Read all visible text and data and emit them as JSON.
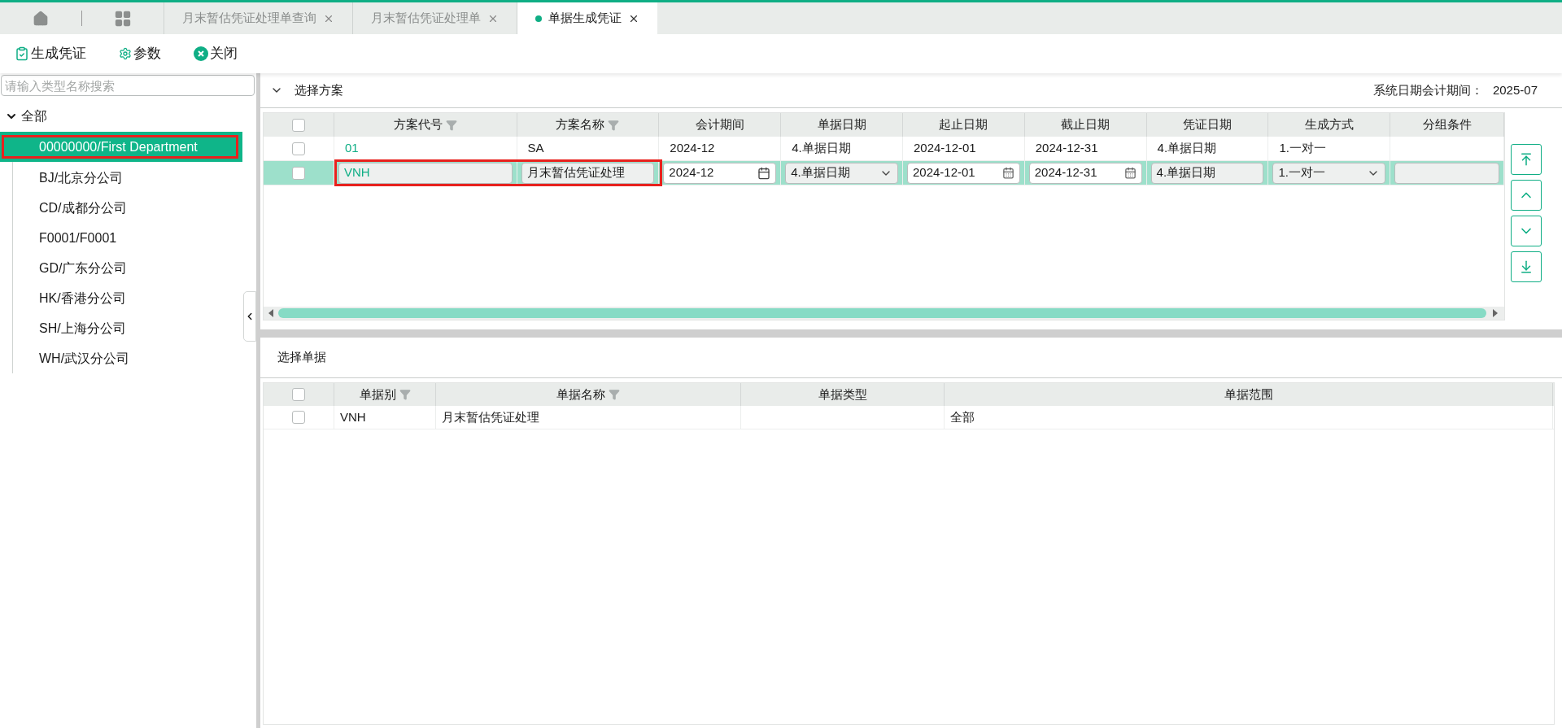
{
  "tabs": [
    {
      "label": "月末暂估凭证处理单查询",
      "selected": false
    },
    {
      "label": "月末暂估凭证处理单",
      "selected": false
    },
    {
      "label": "单据生成凭证",
      "selected": true
    }
  ],
  "toolbar": [
    {
      "kind": "generate",
      "label": "生成凭证"
    },
    {
      "kind": "settings",
      "label": "参数"
    },
    {
      "kind": "close",
      "label": "关闭"
    }
  ],
  "sidebar": {
    "search": {
      "placeholder": "请输入类型名称搜索"
    },
    "tree": {
      "label": "全部",
      "expanded": true,
      "children": [
        {
          "label": "00000000/First Department",
          "selected": true,
          "outlined": true
        },
        {
          "label": "BJ/北京分公司",
          "selected": false,
          "outlined": false
        },
        {
          "label": "CD/成都分公司",
          "selected": false,
          "outlined": false
        },
        {
          "label": "F0001/F0001",
          "selected": false,
          "outlined": false
        },
        {
          "label": "GD/广东分公司",
          "selected": false,
          "outlined": false
        },
        {
          "label": "HK/香港分公司",
          "selected": false,
          "outlined": false
        },
        {
          "label": "SH/上海分公司",
          "selected": false,
          "outlined": false
        },
        {
          "label": "WH/武汉分公司",
          "selected": false,
          "outlined": false
        }
      ]
    }
  },
  "scheme_panel": {
    "title": "选择方案",
    "expanded": true,
    "all_checked": false,
    "period_label": "系统日期会计期间：",
    "period_value": "2025-07",
    "columns": [
      {
        "label": "方案代号",
        "filter": true
      },
      {
        "label": "方案名称",
        "filter": true
      },
      {
        "label": "会计期间",
        "filter": false
      },
      {
        "label": "单据日期",
        "filter": false
      },
      {
        "label": "起止日期",
        "filter": false
      },
      {
        "label": "截止日期",
        "filter": false
      },
      {
        "label": "凭证日期",
        "filter": false
      },
      {
        "label": "生成方式",
        "filter": false
      },
      {
        "label": "分组条件",
        "filter": false
      }
    ],
    "rows": [
      {
        "selected": false,
        "checked": false,
        "cells": [
          {
            "kind": "text",
            "value": "01",
            "outlined": false
          },
          {
            "kind": "text",
            "value": "SA",
            "outlined": false
          },
          {
            "kind": "text",
            "value": "2024-12",
            "outlined": false
          },
          {
            "kind": "text",
            "value": "4.单据日期",
            "outlined": false
          },
          {
            "kind": "text",
            "value": "2024-12-01",
            "outlined": false
          },
          {
            "kind": "text",
            "value": "2024-12-31",
            "outlined": false
          },
          {
            "kind": "text",
            "value": "4.单据日期",
            "outlined": false
          },
          {
            "kind": "text",
            "value": "1.一对一",
            "outlined": false
          },
          {
            "kind": "text",
            "outlined": false
          }
        ]
      },
      {
        "selected": true,
        "checked": false,
        "cells": [
          {
            "kind": "readonly",
            "value": "VNH",
            "outlined": true
          },
          {
            "kind": "readonly",
            "value": "月末暂估凭证处理",
            "outlined": true
          },
          {
            "kind": "month",
            "value": "2024-12",
            "outlined": false
          },
          {
            "kind": "select",
            "value": "4.单据日期",
            "outlined": false
          },
          {
            "kind": "date",
            "value": "2024-12-01",
            "outlined": false
          },
          {
            "kind": "date",
            "value": "2024-12-31",
            "outlined": false
          },
          {
            "kind": "readonly",
            "value": "4.单据日期",
            "outlined": false
          },
          {
            "kind": "select",
            "value": "1.一对一",
            "outlined": false
          },
          {
            "kind": "readonly",
            "outlined": false
          }
        ]
      }
    ],
    "move_buttons": [
      {
        "kind": "top"
      },
      {
        "kind": "up"
      },
      {
        "kind": "down"
      },
      {
        "kind": "bottom"
      }
    ]
  },
  "document_panel": {
    "title": "选择单据",
    "all_checked": false,
    "columns": [
      {
        "label": "单据别",
        "filter": true
      },
      {
        "label": "单据名称",
        "filter": true
      },
      {
        "label": "单据类型",
        "filter": false
      },
      {
        "label": "单据范围",
        "filter": false
      }
    ],
    "rows": [
      {
        "checked": false,
        "cells": [
          "VNH",
          "月末暂估凭证处理",
          "",
          "全部"
        ]
      }
    ]
  }
}
